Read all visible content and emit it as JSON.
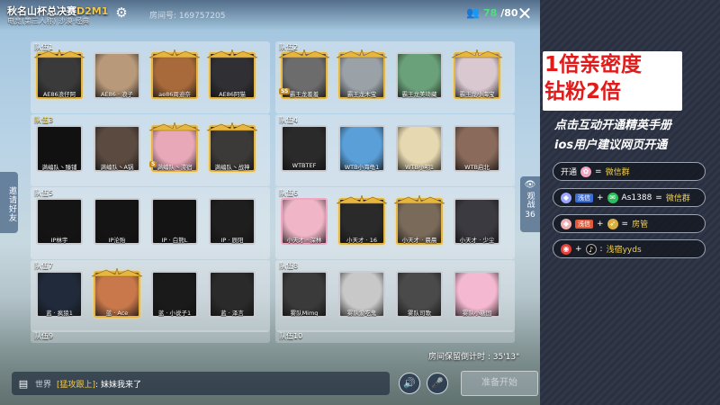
{
  "header": {
    "title_prefix": "秋名山杯总决赛",
    "title_code": "D2M1",
    "subtitle": "电竞(第三人称) 沙漠·经典",
    "room_no": "房间号: 169757205",
    "players_current": "78",
    "players_total": "/80"
  },
  "teams": [
    {
      "label": "队伍1",
      "highlight": false,
      "members": [
        {
          "name": "AE86浪仔阿",
          "frame": "gold",
          "ss": "",
          "color": "#3a3a3a"
        },
        {
          "name": "AE86 · 浪子",
          "frame": "plain",
          "ss": "",
          "color": "#b89a7a"
        },
        {
          "name": "ae86周迪奈",
          "frame": "gold",
          "ss": "",
          "color": "#a86a3a"
        },
        {
          "name": "AE86阿猫",
          "frame": "gold",
          "ss": "",
          "color": "#2f2f34"
        }
      ]
    },
    {
      "label": "队伍2",
      "highlight": false,
      "members": [
        {
          "name": "霸王龙羞羞",
          "frame": "gold",
          "ss": "SS",
          "color": "#6c6c6c"
        },
        {
          "name": "霸王龙木宝",
          "frame": "gold",
          "ss": "",
          "color": "#9aa2a8"
        },
        {
          "name": "霸王龙美琦藏",
          "frame": "plain",
          "ss": "",
          "color": "#6aa17a"
        },
        {
          "name": "霸王龙小海宝",
          "frame": "gold",
          "ss": "",
          "color": "#d9c8d0"
        }
      ]
    },
    {
      "label": "队伍3",
      "highlight": true,
      "members": [
        {
          "name": "满编队丶臻铺",
          "frame": "plain",
          "ss": "",
          "color": "#111111"
        },
        {
          "name": "满编队丶A锅",
          "frame": "plain",
          "ss": "",
          "color": "#5a4a40"
        },
        {
          "name": "满编队丶流宿",
          "frame": "gold",
          "ss": "S",
          "color": "#e8a8b8"
        },
        {
          "name": "满编队丶战神",
          "frame": "gold",
          "ss": "",
          "color": "#3c3a38"
        }
      ]
    },
    {
      "label": "队伍4",
      "highlight": false,
      "members": [
        {
          "name": "WTBTEF",
          "frame": "plain",
          "ss": "",
          "color": "#2a2a2a"
        },
        {
          "name": "WTB小海龟1",
          "frame": "plain",
          "ss": "",
          "color": "#5a9fd8"
        },
        {
          "name": "WTB小明1",
          "frame": "plain",
          "ss": "",
          "color": "#e6d8b0"
        },
        {
          "name": "WTB启北",
          "frame": "plain",
          "ss": "",
          "color": "#8a6a5a"
        }
      ]
    },
    {
      "label": "队伍5",
      "highlight": false,
      "members": [
        {
          "name": "IP林宇",
          "frame": "plain",
          "ss": "",
          "color": "#141414"
        },
        {
          "name": "IP沦殆",
          "frame": "plain",
          "ss": "",
          "color": "#141414"
        },
        {
          "name": "IP · 白熊L",
          "frame": "plain",
          "ss": "",
          "color": "#141414"
        },
        {
          "name": "IP · 辰阳",
          "frame": "plain",
          "ss": "",
          "color": "#1e1e1e"
        }
      ]
    },
    {
      "label": "队伍6",
      "highlight": false,
      "members": [
        {
          "name": "小天才 · 深林",
          "frame": "pink",
          "ss": "",
          "color": "#f0b6c8"
        },
        {
          "name": "小天才 · 16",
          "frame": "gold",
          "ss": "",
          "color": "#2a2a2a"
        },
        {
          "name": "小天才 · 晨晨",
          "frame": "gold",
          "ss": "",
          "color": "#7a6a5a"
        },
        {
          "name": "小天才 · 少尘",
          "frame": "plain",
          "ss": "",
          "color": "#3a3a40"
        }
      ]
    },
    {
      "label": "队伍7",
      "highlight": false,
      "members": [
        {
          "name": "蓝 · 疯狼1",
          "frame": "plain",
          "ss": "",
          "color": "#202a3a"
        },
        {
          "name": "蓝 · Ace",
          "frame": "gold",
          "ss": "",
          "color": "#c8784a"
        },
        {
          "name": "蓝 · 小说子1",
          "frame": "plain",
          "ss": "",
          "color": "#1a1a1a"
        },
        {
          "name": "蓝 · 泽言",
          "frame": "plain",
          "ss": "",
          "color": "#2a2a2a"
        }
      ]
    },
    {
      "label": "队伍8",
      "highlight": false,
      "members": [
        {
          "name": "雾队Mimg",
          "frame": "plain",
          "ss": "",
          "color": "#3a3a3a"
        },
        {
          "name": "雾队爱吃鬼",
          "frame": "plain",
          "ss": "",
          "color": "#c8c8c8"
        },
        {
          "name": "雾队司歌",
          "frame": "plain",
          "ss": "",
          "color": "#4a4a4a"
        },
        {
          "name": "雾队小糖国",
          "frame": "plain",
          "ss": "",
          "color": "#f4b8d0"
        }
      ]
    }
  ],
  "team9_label": "队伍9",
  "team10_label": "队伍10",
  "invite_label": "邀请好友",
  "watch_label": "观战",
  "watch_count": "36",
  "timer": "房间保留倒计时 : 35'13\"",
  "chat": {
    "channel": "世界",
    "sender": "[猛攻跟上]",
    "message": ": 妹妹我来了"
  },
  "start_button": "准备开始",
  "promo": {
    "line1": "1倍亲密度",
    "line2": "钻粉2倍",
    "sub1": "点击互动开通精英手册",
    "sub2": "ios用户建议网页开通"
  },
  "rows": [
    {
      "a": "开通",
      "b": "=",
      "c": "微信群"
    },
    {
      "a": "浅信",
      "b": "+",
      "c": "As1388",
      "d": "=",
      "e": "微信群"
    },
    {
      "a": "浅信",
      "b": "+",
      "c": "=",
      "d": "房管"
    },
    {
      "a": "+",
      "b": ":",
      "c": "浅宿yyds"
    }
  ],
  "colors": {
    "accent_gold": "#e7b640",
    "promo_red": "#e11a1a",
    "players_green": "#4fe07a"
  }
}
